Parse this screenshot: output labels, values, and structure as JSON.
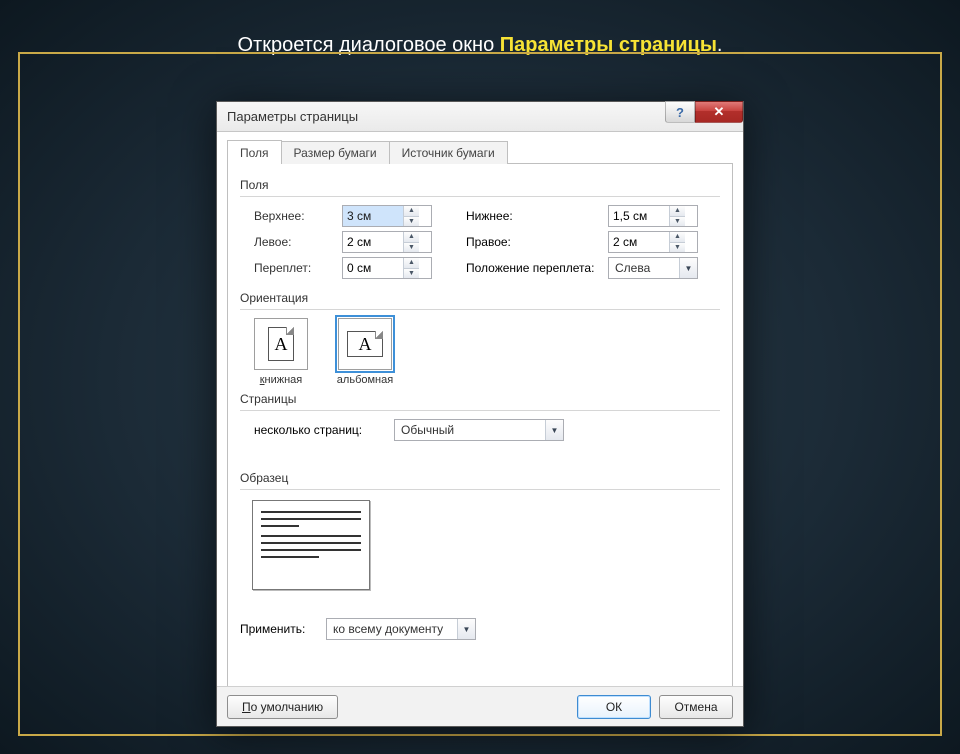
{
  "slide": {
    "caption_plain": "Откроется диалоговое окно ",
    "caption_bold": "Параметры страницы",
    "caption_tail": "."
  },
  "dialog": {
    "title": "Параметры страницы",
    "help_glyph": "?",
    "close_glyph": "✕"
  },
  "tabs": [
    {
      "label": "Поля",
      "active": true
    },
    {
      "label": "Размер бумаги",
      "active": false
    },
    {
      "label": "Источник бумаги",
      "active": false
    }
  ],
  "groups": {
    "fields_label": "Поля",
    "orientation_label": "Ориентация",
    "pages_label": "Страницы",
    "sample_label": "Образец"
  },
  "fields": {
    "top_label": "Верхнее:",
    "top_value": "3 см",
    "bottom_label": "Нижнее:",
    "bottom_value": "1,5 см",
    "left_label": "Левое:",
    "left_value": "2 см",
    "right_label": "Правое:",
    "right_value": "2 см",
    "gutter_label": "Переплет:",
    "gutter_value": "0 см",
    "gutter_pos_label": "Положение переплета:",
    "gutter_pos_value": "Слева"
  },
  "orientation": {
    "portrait": "книжная",
    "landscape": "альбомная",
    "glyph": "A",
    "selected": "landscape"
  },
  "pages": {
    "multi_label": "несколько страниц:",
    "multi_value": "Обычный"
  },
  "apply": {
    "label": "Применить:",
    "value": "ко всему документу"
  },
  "buttons": {
    "default": "По умолчанию",
    "ok": "ОК",
    "cancel": "Отмена"
  }
}
